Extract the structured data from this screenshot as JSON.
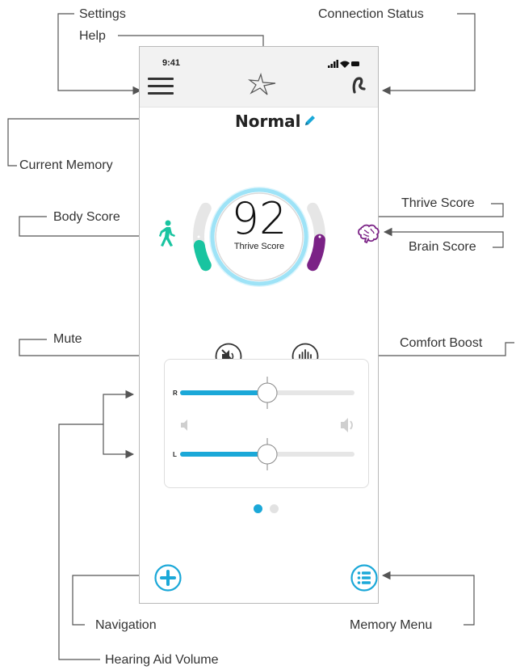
{
  "annotations": {
    "settings": "Settings",
    "help": "Help",
    "connection_status": "Connection Status",
    "current_memory": "Current Memory",
    "body_score": "Body Score",
    "thrive_score": "Thrive Score",
    "brain_score": "Brain Score",
    "mute": "Mute",
    "comfort_boost": "Comfort Boost",
    "navigation": "Navigation",
    "memory_menu": "Memory Menu",
    "hearing_aid_volume": "Hearing Aid Volume"
  },
  "status_bar": {
    "time": "9:41"
  },
  "memory": {
    "name": "Normal"
  },
  "thrive": {
    "score": "92",
    "label": "Thrive Score"
  },
  "gauges": {
    "body_level": 0.35,
    "brain_level": 0.45
  },
  "volume": {
    "right_label": "R",
    "left_label": "L",
    "right_level": 0.5,
    "left_level": 0.5
  },
  "pager": {
    "pages": 2,
    "active": 0
  },
  "colors": {
    "accent": "#1ba8d8",
    "body": "#19c4a0",
    "brain": "#7b2286",
    "track": "#e6e6e6",
    "glow": "#9ee3f7"
  },
  "icons": {
    "menu": "hamburger-icon",
    "help": "star-logo-icon",
    "connection": "hearing-aid-icon",
    "edit": "pencil-icon",
    "body": "walking-person-icon",
    "brain": "brain-icon",
    "mute": "speaker-muted-icon",
    "comfort": "sound-wave-icon",
    "add": "plus-icon",
    "list": "list-icon"
  }
}
